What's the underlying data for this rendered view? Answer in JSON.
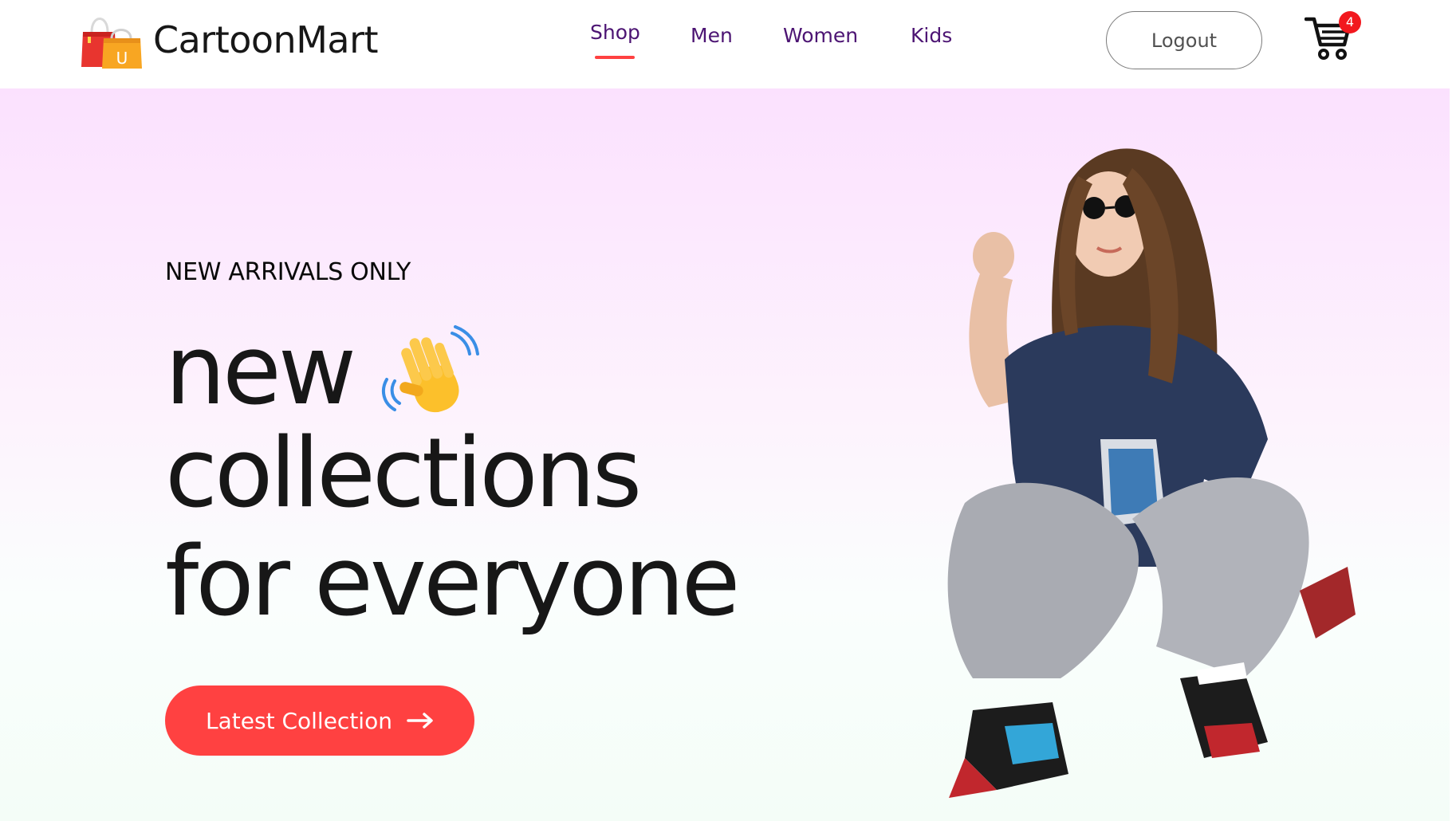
{
  "brand": {
    "name": "CartoonMart",
    "logo_icon": "shopping-bag-icon",
    "logo_letter": "U"
  },
  "nav": {
    "items": [
      {
        "label": "Shop",
        "active": true
      },
      {
        "label": "Men",
        "active": false
      },
      {
        "label": "Women",
        "active": false
      },
      {
        "label": "Kids",
        "active": false
      }
    ]
  },
  "header": {
    "logout_label": "Logout",
    "cart_icon": "cart-icon",
    "cart_count": "4"
  },
  "hero": {
    "kicker": "NEW ARRIVALS ONLY",
    "line1": "new",
    "line2": "collections",
    "line3": "for everyone",
    "wave_icon": "waving-hand-icon",
    "cta_label": "Latest Collection",
    "cta_icon": "arrow-right-icon",
    "image": "hero-model-image"
  },
  "colors": {
    "accent": "#ff4141",
    "nav_text": "#4c1473",
    "hero_gradient_top": "#fbe1fe",
    "hero_gradient_bottom": "#f4fdf7",
    "badge": "#f2181e"
  }
}
